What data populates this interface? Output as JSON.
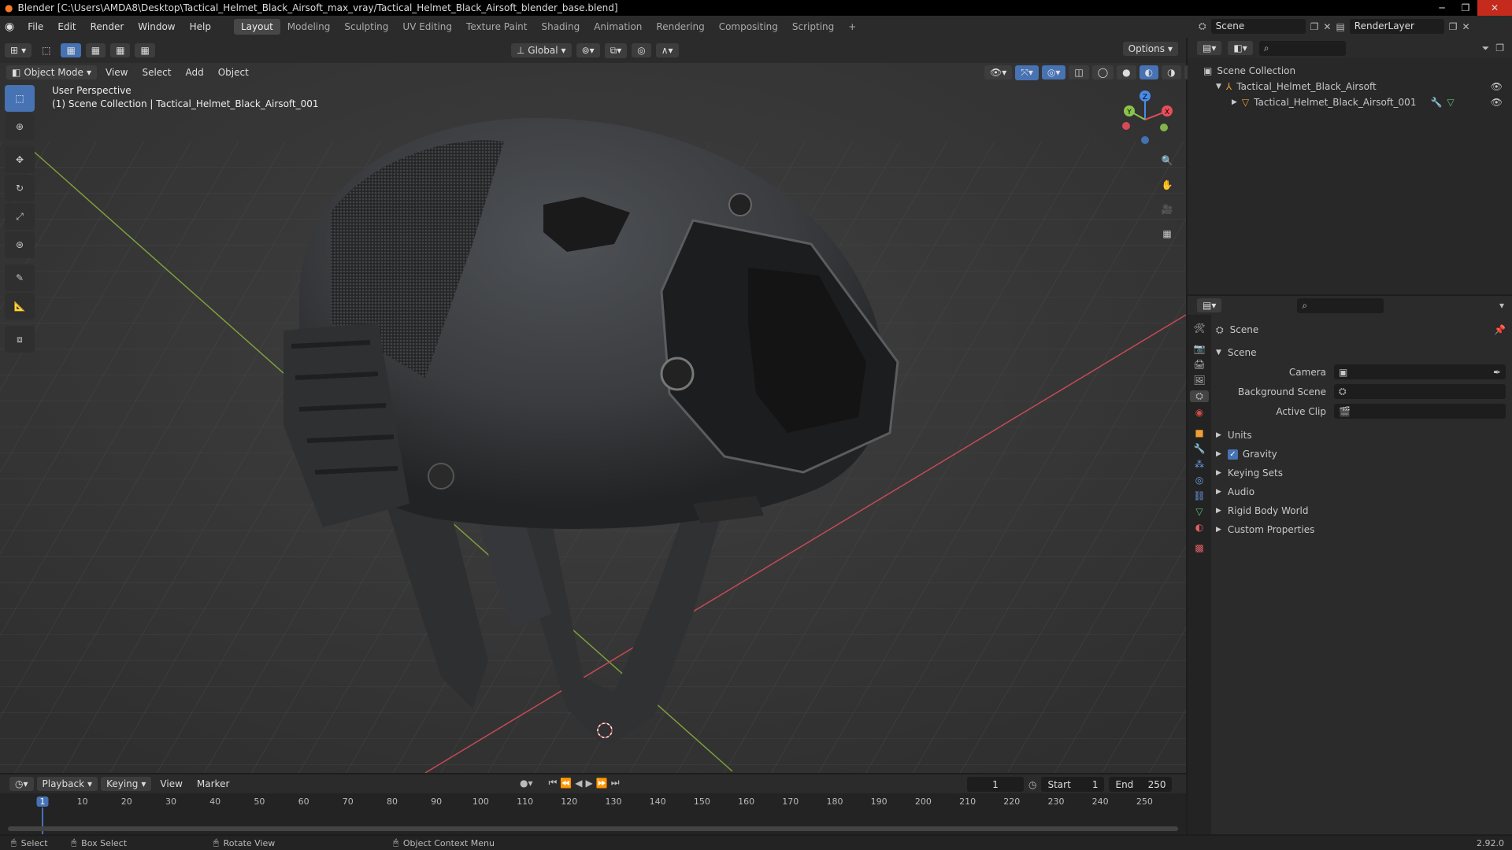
{
  "title": "Blender [C:\\Users\\AMDA8\\Desktop\\Tactical_Helmet_Black_Airsoft_max_vray/Tactical_Helmet_Black_Airsoft_blender_base.blend]",
  "menus": [
    "File",
    "Edit",
    "Render",
    "Window",
    "Help"
  ],
  "workspaces": [
    "Layout",
    "Modeling",
    "Sculpting",
    "UV Editing",
    "Texture Paint",
    "Shading",
    "Animation",
    "Rendering",
    "Compositing",
    "Scripting"
  ],
  "active_workspace": "Layout",
  "top_right": {
    "scene": "Scene",
    "render_layer": "RenderLayer"
  },
  "viewport_header": {
    "mode": "Object Mode",
    "menus": [
      "View",
      "Select",
      "Add",
      "Object"
    ],
    "transform": "Global",
    "options": "Options"
  },
  "viewport": {
    "perspective": "User Perspective",
    "collection_info": "(1) Scene Collection | Tactical_Helmet_Black_Airsoft_001"
  },
  "gizmo": {
    "x": "X",
    "y": "Y",
    "z": "Z"
  },
  "outliner": {
    "root": "Scene Collection",
    "items": [
      {
        "label": "Tactical_Helmet_Black_Airsoft"
      },
      {
        "label": "Tactical_Helmet_Black_Airsoft_001"
      }
    ]
  },
  "properties": {
    "header": "Scene",
    "section": "Scene",
    "fields": [
      {
        "label": "Camera"
      },
      {
        "label": "Background Scene"
      },
      {
        "label": "Active Clip"
      }
    ],
    "panels": [
      "Units",
      "Gravity",
      "Keying Sets",
      "Audio",
      "Rigid Body World",
      "Custom Properties"
    ],
    "gravity_checked": true
  },
  "timeline": {
    "menus": [
      "Playback",
      "Keying",
      "View",
      "Marker"
    ],
    "current_frame": "1",
    "start_label": "Start",
    "start": "1",
    "end_label": "End",
    "end": "250",
    "ticks": [
      "1",
      "10",
      "20",
      "30",
      "40",
      "50",
      "60",
      "70",
      "80",
      "90",
      "100",
      "110",
      "120",
      "130",
      "140",
      "150",
      "160",
      "170",
      "180",
      "190",
      "200",
      "210",
      "220",
      "230",
      "240",
      "250"
    ]
  },
  "statusbar": {
    "select": "Select",
    "box_select": "Box Select",
    "rotate_view": "Rotate View",
    "context_menu": "Object Context Menu",
    "version": "2.92.0"
  },
  "colors": {
    "accent": "#4772b3",
    "x_axis": "#e84d5b",
    "y_axis": "#8bc34a",
    "z_axis": "#4a8be8"
  }
}
